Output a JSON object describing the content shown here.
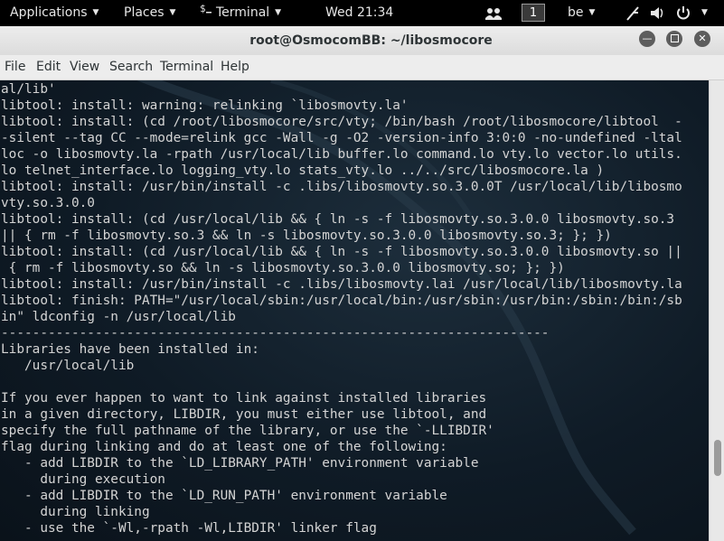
{
  "topbar": {
    "applications": "Applications",
    "places": "Places",
    "terminal": "Terminal",
    "clock": "Wed 21:34",
    "workspace": "1",
    "keyboard_layout": "be"
  },
  "window": {
    "title": "root@OsmocomBB: ~/libosmocore",
    "menu": [
      "File",
      "Edit",
      "View",
      "Search",
      "Terminal",
      "Help"
    ]
  },
  "terminal": {
    "lines": [
      "al/lib'",
      "libtool: install: warning: relinking `libosmovty.la'",
      "libtool: install: (cd /root/libosmocore/src/vty; /bin/bash /root/libosmocore/libtool  -",
      "-silent --tag CC --mode=relink gcc -Wall -g -O2 -version-info 3:0:0 -no-undefined -ltal",
      "loc -o libosmovty.la -rpath /usr/local/lib buffer.lo command.lo vty.lo vector.lo utils.",
      "lo telnet_interface.lo logging_vty.lo stats_vty.lo ../../src/libosmocore.la )",
      "libtool: install: /usr/bin/install -c .libs/libosmovty.so.3.0.0T /usr/local/lib/libosmo",
      "vty.so.3.0.0",
      "libtool: install: (cd /usr/local/lib && { ln -s -f libosmovty.so.3.0.0 libosmovty.so.3",
      "|| { rm -f libosmovty.so.3 && ln -s libosmovty.so.3.0.0 libosmovty.so.3; }; })",
      "libtool: install: (cd /usr/local/lib && { ln -s -f libosmovty.so.3.0.0 libosmovty.so ||",
      " { rm -f libosmovty.so && ln -s libosmovty.so.3.0.0 libosmovty.so; }; })",
      "libtool: install: /usr/bin/install -c .libs/libosmovty.lai /usr/local/lib/libosmovty.la",
      "libtool: finish: PATH=\"/usr/local/sbin:/usr/local/bin:/usr/sbin:/usr/bin:/sbin:/bin:/sb",
      "in\" ldconfig -n /usr/local/lib",
      "----------------------------------------------------------------------",
      "Libraries have been installed in:",
      "   /usr/local/lib",
      "",
      "If you ever happen to want to link against installed libraries",
      "in a given directory, LIBDIR, you must either use libtool, and",
      "specify the full pathname of the library, or use the `-LLIBDIR'",
      "flag during linking and do at least one of the following:",
      "   - add LIBDIR to the `LD_LIBRARY_PATH' environment variable",
      "     during execution",
      "   - add LIBDIR to the `LD_RUN_PATH' environment variable",
      "     during linking",
      "   - use the `-Wl,-rpath -Wl,LIBDIR' linker flag"
    ]
  },
  "colors": {
    "topbar_bg": "#000000",
    "terminal_text": "#d4d4d4",
    "terminal_bg": "#0f1b26"
  }
}
